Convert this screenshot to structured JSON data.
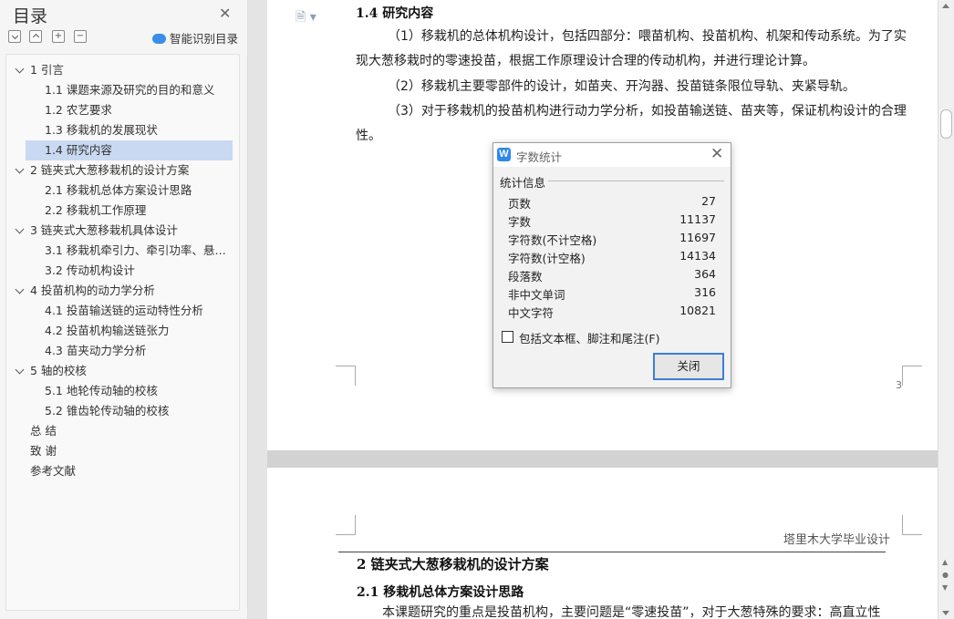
{
  "sidebar": {
    "title": "目录",
    "smart_toc": "智能识别目录",
    "toolbar": {
      "collapse": "−",
      "expand": "^",
      "add": "+",
      "remove": "−"
    },
    "items": [
      {
        "label": "1 引言",
        "level": 1,
        "expandable": true
      },
      {
        "label": "1.1 课题来源及研究的目的和意义",
        "level": 2
      },
      {
        "label": "1.2 农艺要求",
        "level": 2
      },
      {
        "label": "1.3 移栽机的发展现状",
        "level": 2
      },
      {
        "label": "1.4 研究内容",
        "level": 2,
        "active": true
      },
      {
        "label": "2  链夹式大葱移栽机的设计方案",
        "level": 1,
        "expandable": true
      },
      {
        "label": "2.1 移栽机总体方案设计思路",
        "level": 2
      },
      {
        "label": "2.2 移栽机工作原理",
        "level": 2
      },
      {
        "label": "3  链夹式大葱移栽机具体设计",
        "level": 1,
        "expandable": true
      },
      {
        "label": "3.1 移栽机牵引力、牵引功率、悬…",
        "level": 2
      },
      {
        "label": "3.2 传动机构设计",
        "level": 2
      },
      {
        "label": "4  投苗机构的动力学分析",
        "level": 1,
        "expandable": true
      },
      {
        "label": "4.1 投苗输送链的运动特性分析",
        "level": 2
      },
      {
        "label": "4.2 投苗机构输送链张力",
        "level": 2
      },
      {
        "label": "4.3 苗夹动力学分析",
        "level": 2
      },
      {
        "label": "5  轴的校核",
        "level": 1,
        "expandable": true
      },
      {
        "label": "5.1 地轮传动轴的校核",
        "level": 2
      },
      {
        "label": "5.2 锥齿轮传动轴的校核",
        "level": 2
      },
      {
        "label": "总  结",
        "level": 1
      },
      {
        "label": "致  谢",
        "level": 1
      },
      {
        "label": "参考文献",
        "level": 1
      }
    ]
  },
  "document": {
    "page1": {
      "heading": "1.4 研究内容",
      "lines": [
        "（1）移栽机的总体机构设计，包括四部分：喂苗机构、投苗机构、机架和传动系统。为了实",
        "现大葱移栽时的零速投苗，根据工作原理设计合理的传动机构，并进行理论计算。",
        "（2）移栽机主要零部件的设计，如苗夹、开沟器、投苗链条限位导轨、夹紧导轨。",
        "（3）对于移栽机的投苗机构进行动力学分析，如投苗输送链、苗夹等，保证机构设计的合理",
        "性。"
      ],
      "page_number": "3"
    },
    "page2": {
      "header": "塔里木大学毕业设计",
      "chapter_title": "2  链夹式大葱移栽机的设计方案",
      "section_title": "2.1 移栽机总体方案设计思路",
      "partial_line": "本课题研究的重点是投苗机构，主要问题是“零速投苗”，对于大葱特殊的要求：高直立性"
    }
  },
  "dialog": {
    "title": "字数统计",
    "group_label": "统计信息",
    "stats": [
      {
        "label": "页数",
        "value": "27"
      },
      {
        "label": "字数",
        "value": "11137"
      },
      {
        "label": "字符数(不计空格)",
        "value": "11697"
      },
      {
        "label": "字符数(计空格)",
        "value": "14134"
      },
      {
        "label": "段落数",
        "value": "364"
      },
      {
        "label": "非中文单词",
        "value": "316"
      },
      {
        "label": "中文字符",
        "value": "10821"
      }
    ],
    "checkbox_label": "包括文本框、脚注和尾注(F)",
    "checkbox_checked": false,
    "close_button": "关闭"
  }
}
